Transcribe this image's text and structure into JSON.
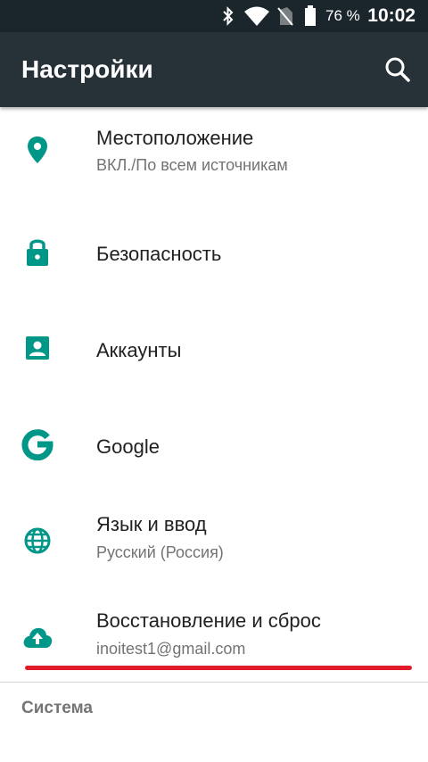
{
  "status_bar": {
    "battery_percent": "76 %",
    "time": "10:02",
    "icons": [
      "bluetooth-icon",
      "wifi-icon",
      "no-sim-icon",
      "battery-icon"
    ]
  },
  "toolbar": {
    "title": "Настройки",
    "search_icon": "search-icon"
  },
  "items": [
    {
      "icon": "location-icon",
      "title": "Местоположение",
      "subtitle": "ВКЛ./По всем источникам"
    },
    {
      "icon": "lock-icon",
      "title": "Безопасность",
      "subtitle": ""
    },
    {
      "icon": "account-box-icon",
      "title": "Аккаунты",
      "subtitle": ""
    },
    {
      "icon": "google-icon",
      "title": "Google",
      "subtitle": ""
    },
    {
      "icon": "globe-icon",
      "title": "Язык и ввод",
      "subtitle": "Русский (Россия)"
    },
    {
      "icon": "cloud-upload-icon",
      "title": "Восстановление и сброс",
      "subtitle": "inoitest1@gmail.com"
    }
  ],
  "section": {
    "title": "Система"
  },
  "colors": {
    "accent": "#009688",
    "toolbar": "#263238",
    "status_bar": "#1b262c",
    "highlight_line": "#e21b2b"
  }
}
